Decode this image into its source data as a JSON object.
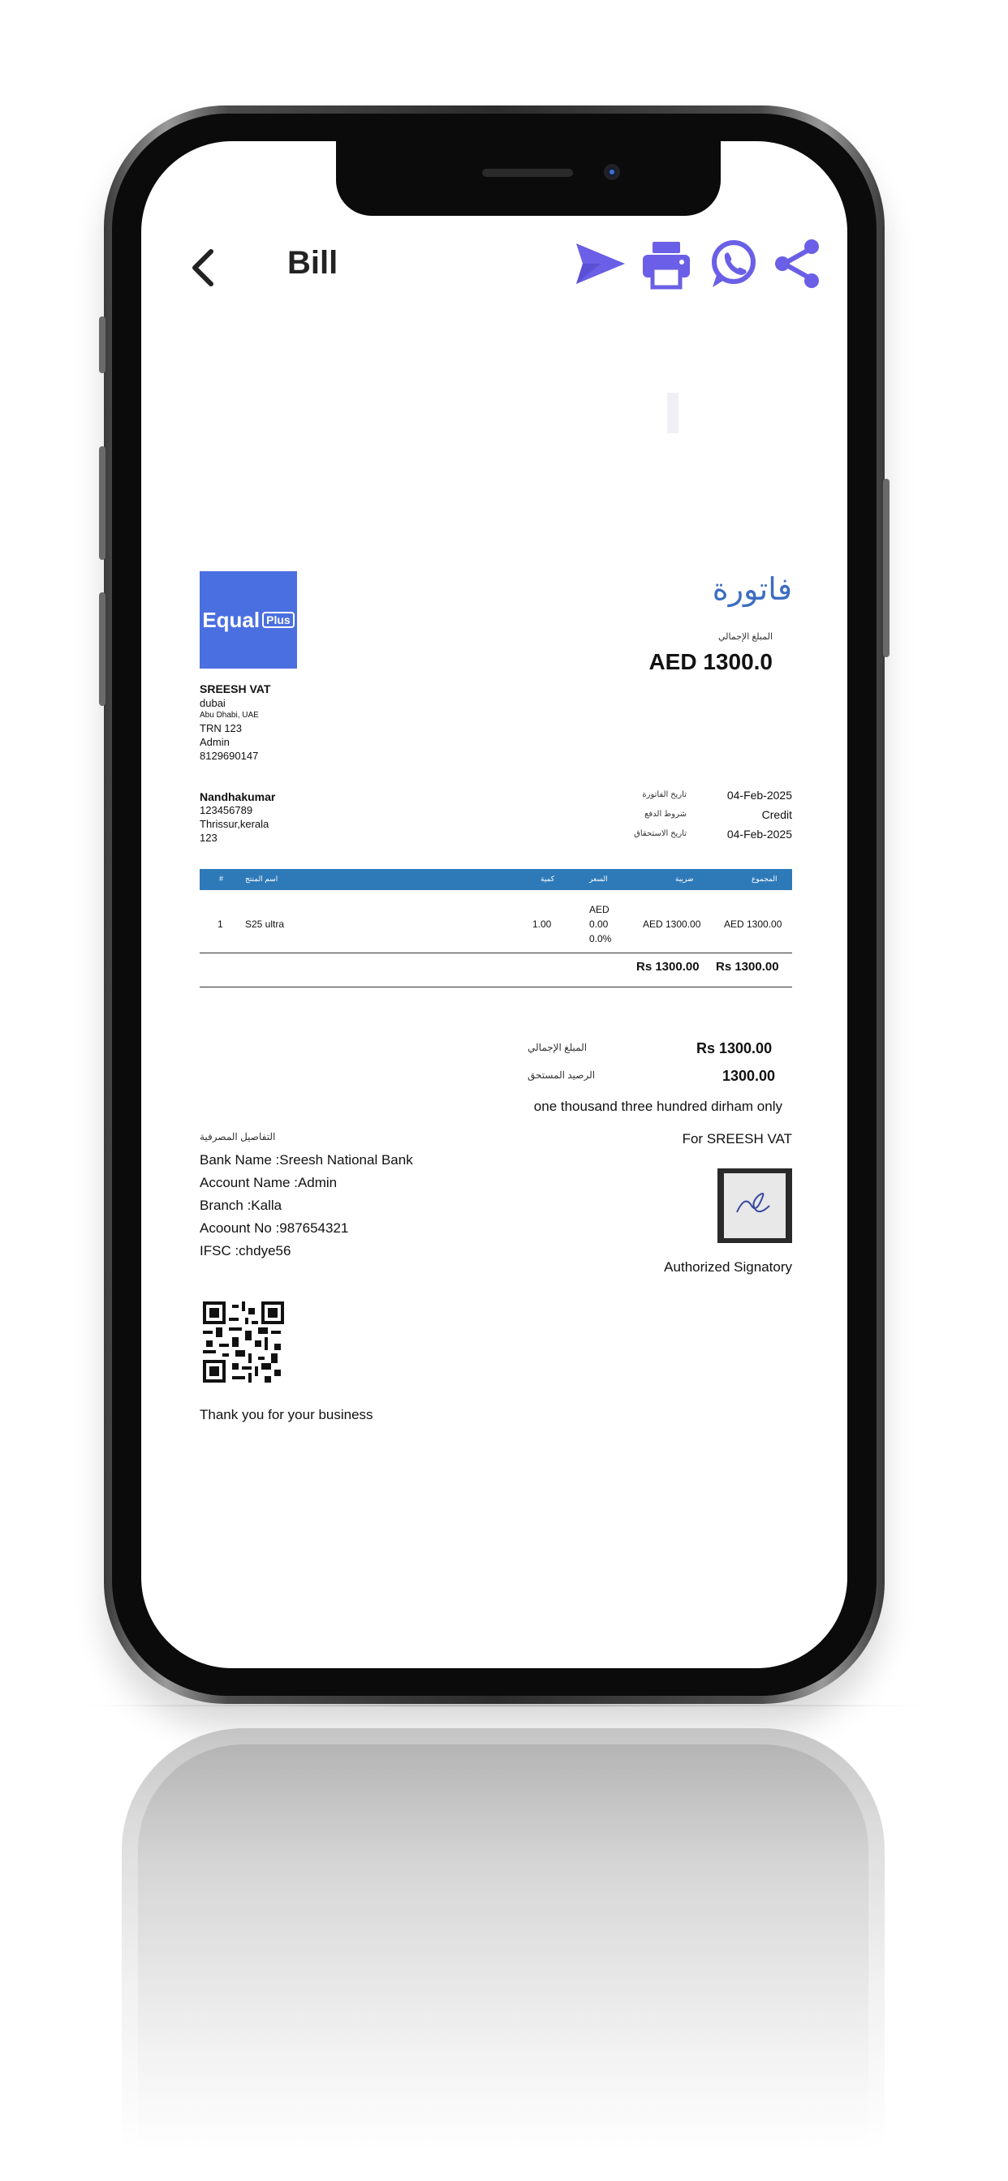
{
  "app_bar": {
    "title": "Bill",
    "icons": [
      "back-icon",
      "send-icon",
      "print-icon",
      "whatsapp-icon",
      "share-icon"
    ],
    "accent": "#6a5fe6"
  },
  "company": {
    "logo_text": "Equal",
    "logo_badge": "Plus",
    "name": "SREESH VAT",
    "lines": [
      "dubai",
      "Abu Dhabi, UAE",
      "TRN 123",
      "Admin",
      "8129690147"
    ]
  },
  "invoice": {
    "title_ar": "فاتورة",
    "total_label_ar": "المبلغ الإجمالي",
    "total_amount": "AED 1300.0"
  },
  "customer": {
    "name": "Nandhakumar",
    "lines": [
      "123456789",
      "Thrissur,kerala",
      "123"
    ]
  },
  "meta": [
    {
      "label_ar": "تاريخ الفاتورة",
      "value": "04-Feb-2025"
    },
    {
      "label_ar": "شروط الدفع",
      "value": "Credit"
    },
    {
      "label_ar": "تاريخ الاستحقاق",
      "value": "04-Feb-2025"
    }
  ],
  "table": {
    "header_color": "#2e7ab8",
    "headers": [
      "#",
      "اسم المنتج",
      "كمية",
      "السعر",
      "ضريبة",
      "المجموع"
    ],
    "rows": [
      {
        "no": "1",
        "item": "S25 ultra",
        "qty": "1.00",
        "price": "AED",
        "price2": "0.00",
        "price3": "0.0%",
        "tax": "AED 1300.00",
        "total": "AED 1300.00"
      }
    ],
    "sum_tax": "Rs 1300.00",
    "sum_total": "Rs 1300.00"
  },
  "totals": [
    {
      "label_ar": "المبلغ الإجمالي",
      "value": "Rs 1300.00"
    },
    {
      "label_ar": "الرصيد المستحق",
      "value": "1300.00"
    }
  ],
  "amount_in_words": "one thousand three hundred dirham only",
  "bank": {
    "title_ar": "التفاصيل المصرفية",
    "lines": [
      "Bank Name :Sreesh National Bank",
      "Account Name :Admin",
      "Branch :Kalla",
      "Acoount No :987654321",
      "IFSC :chdye56"
    ]
  },
  "signatory": {
    "for_company": "For SREESH VAT",
    "label": "Authorized Signatory"
  },
  "footer": {
    "thanks": "Thank you for your business"
  }
}
